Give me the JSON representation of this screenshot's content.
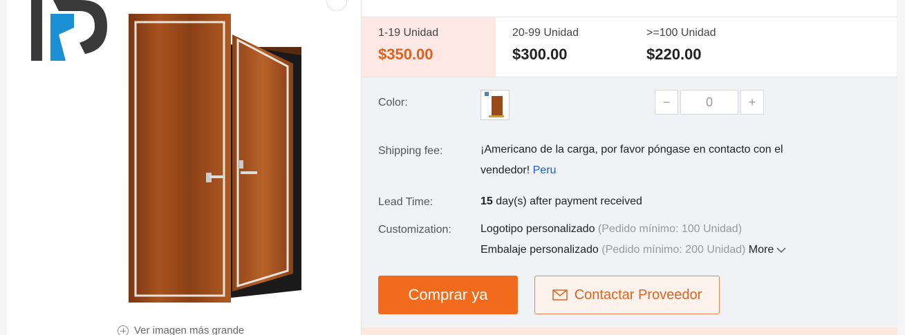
{
  "gallery": {
    "logo_icon": "brand-logo-icon",
    "door_image_icon": "wooden-double-door-image",
    "enlarge_label": "Ver imagen más grande",
    "enlarge_icon": "zoom-in-icon"
  },
  "price_tiers": [
    {
      "qty": "1-19 Unidad",
      "price": "$350.00"
    },
    {
      "qty": "20-99 Unidad",
      "price": "$300.00"
    },
    {
      "qty": ">=100 Unidad",
      "price": "$220.00"
    }
  ],
  "color": {
    "label": "Color:",
    "quantity": "0",
    "minus": "−",
    "plus": "+"
  },
  "shipping": {
    "label": "Shipping fee:",
    "line1": "¡Americano de la carga, por favor póngase en contacto con el",
    "line2": "vendedor!",
    "link": "Peru"
  },
  "lead_time": {
    "label": "Lead Time:",
    "days": "15",
    "suffix": "day(s) after payment received"
  },
  "customization": {
    "label": "Customization:",
    "item1": "Logotipo personalizado",
    "item1_note": "(Pedido mínimo: 100 Unidad)",
    "item2": "Embalaje personalizado",
    "item2_note": "(Pedido mínimo: 200 Unidad)",
    "more": "More"
  },
  "actions": {
    "buy": "Comprar ya",
    "contact": "Contactar Proveedor"
  },
  "colors": {
    "accent": "#f26b1d",
    "active_tier_bg": "#fde8e4",
    "link": "#1a5dcc"
  }
}
